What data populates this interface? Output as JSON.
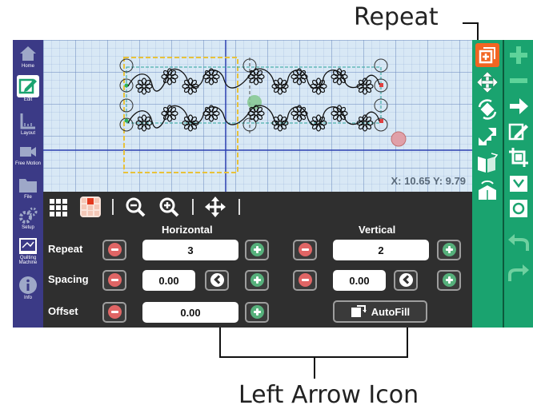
{
  "callouts": {
    "top": "Repeat",
    "bottom": "Left Arrow Icon"
  },
  "sidebar": {
    "items": [
      {
        "label": "Home",
        "icon": "home-icon"
      },
      {
        "label": "Edit",
        "icon": "edit-icon",
        "active": true
      },
      {
        "label": "Layout",
        "icon": "layout-icon"
      },
      {
        "label": "Free Motion",
        "icon": "camera-icon"
      },
      {
        "label": "File",
        "icon": "folder-icon"
      },
      {
        "label": "Setup",
        "icon": "gears-icon"
      },
      {
        "label": "Quilting Machine",
        "icon": "machine-icon"
      },
      {
        "label": "Info",
        "icon": "info-icon"
      }
    ]
  },
  "canvas": {
    "coords": "X: 10.65 Y: 9.79"
  },
  "panel": {
    "horizontal_header": "Horizontal",
    "vertical_header": "Vertical",
    "rows": {
      "repeat": {
        "label": "Repeat",
        "h_value": "3",
        "v_value": "2"
      },
      "spacing": {
        "label": "Spacing",
        "h_value": "0.00",
        "v_value": "0.00"
      },
      "offset": {
        "label": "Offset",
        "h_value": "0.00"
      }
    },
    "autofill_label": "AutoFill"
  },
  "colors": {
    "sidebar": "#3b3a86",
    "right_toolbar": "#1aa36f",
    "selected_tool": "#f26522",
    "canvas": "#d8e8f5",
    "panel": "#2f2f2f"
  }
}
